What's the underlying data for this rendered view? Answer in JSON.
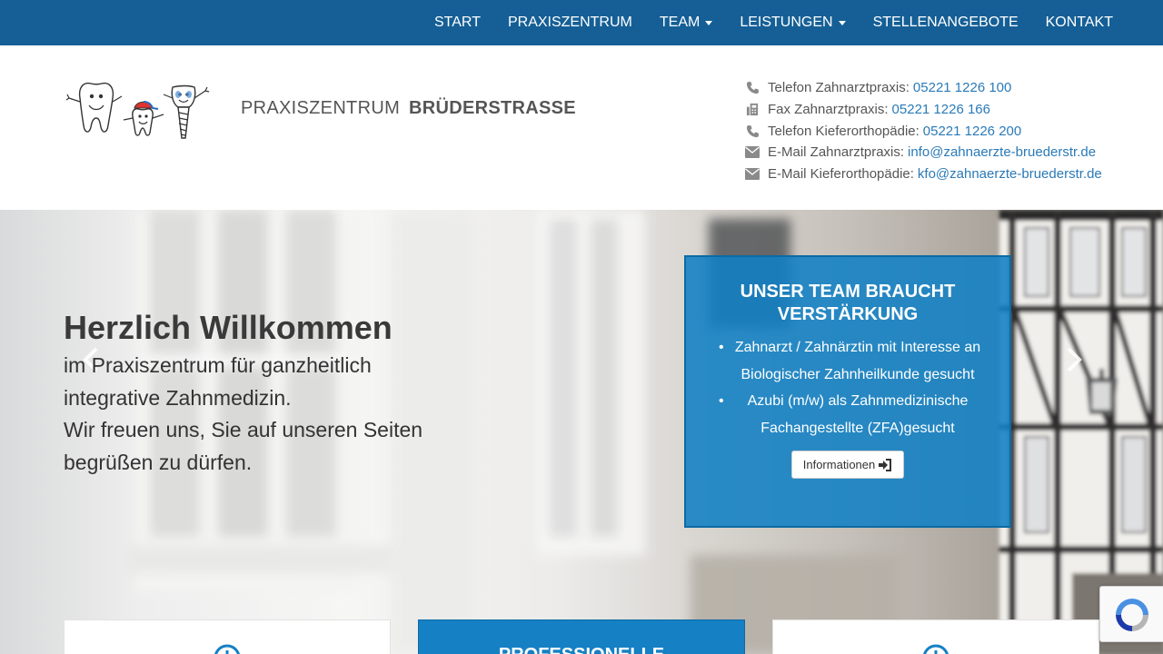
{
  "nav": {
    "items": [
      {
        "label": "START",
        "dropdown": false
      },
      {
        "label": "PRAXISZENTRUM",
        "dropdown": false
      },
      {
        "label": "TEAM",
        "dropdown": true
      },
      {
        "label": "LEISTUNGEN",
        "dropdown": true
      },
      {
        "label": "STELLENANGEBOTE",
        "dropdown": false
      },
      {
        "label": "KONTAKT",
        "dropdown": false
      }
    ]
  },
  "header": {
    "brand_light": "PRAXISZENTRUM",
    "brand_bold": "BRÜDERSTRASSE",
    "contact": [
      {
        "icon": "phone-icon",
        "label": "Telefon Zahnarztpraxis:",
        "value": "05221 1226 100"
      },
      {
        "icon": "fax-icon",
        "label": "Fax Zahnarztpraxis:",
        "value": "05221 1226 166"
      },
      {
        "icon": "phone-icon",
        "label": "Telefon Kieferorthopädie:",
        "value": "05221 1226 200"
      },
      {
        "icon": "envelope-icon",
        "label": "E-Mail Zahnarztpraxis:",
        "value": "info@zahnaerzte-bruederstr.de"
      },
      {
        "icon": "envelope-icon",
        "label": "E-Mail Kieferorthopädie:",
        "value": "kfo@zahnaerzte-bruederstr.de"
      }
    ]
  },
  "hero": {
    "title": "Herzlich Willkommen",
    "line1": "im Praxiszentrum für ganzheitlich integrative Zahnmedizin.",
    "line2": "Wir freuen uns, Sie auf unseren Seiten begrüßen zu dürfen."
  },
  "job_box": {
    "title": "UNSER TEAM BRAUCHT VERSTÄRKUNG",
    "items": [
      "Zahnarzt / Zahnärztin mit Interesse an Biologischer Zahnheilkunde gesucht",
      "Azubi (m/w) als Zahnmedizinische Fachangestellte (ZFA)gesucht"
    ],
    "button_label": "Informationen"
  },
  "cards": {
    "middle_title": "PROFESSIONELLE"
  },
  "colors": {
    "nav_bg": "#155f96",
    "link": "#2a7ab8",
    "job_box_bg": "#1580c4"
  }
}
